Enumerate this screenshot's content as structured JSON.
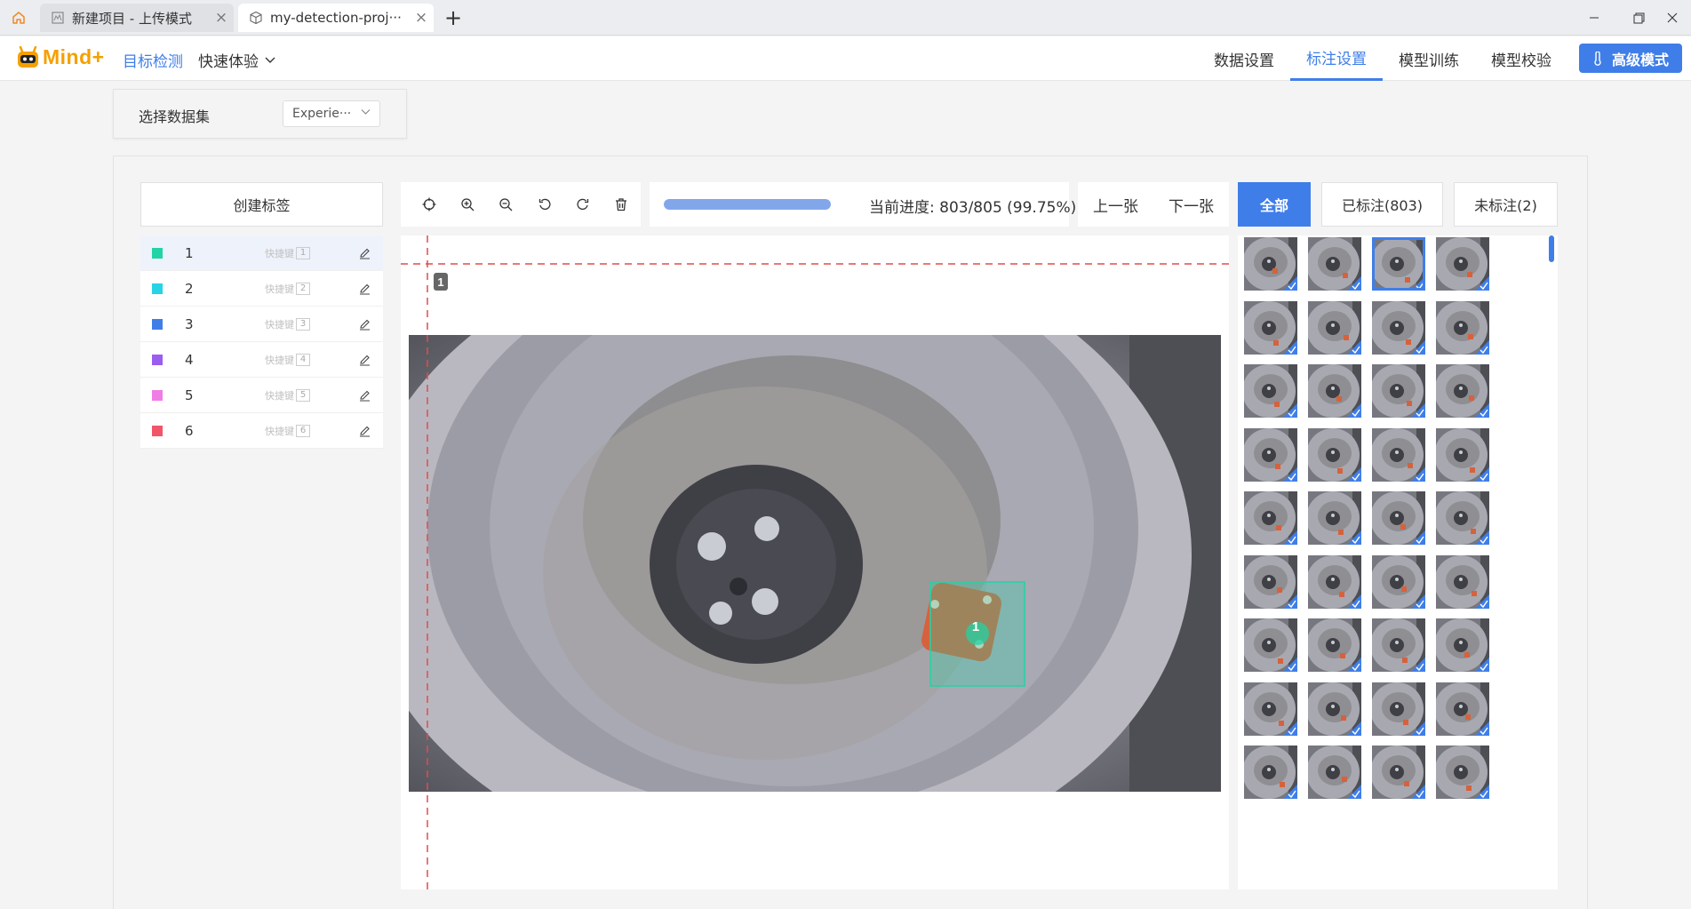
{
  "titlebar": {
    "tabs": [
      {
        "label": "新建项目 - 上传模式"
      },
      {
        "label": "my-detection-proj···"
      }
    ]
  },
  "navbar": {
    "logo_text": "Mind+",
    "mode": "目标检测",
    "experience": "快速体验",
    "tabs": [
      {
        "label": "数据设置",
        "active": false
      },
      {
        "label": "标注设置",
        "active": true
      },
      {
        "label": "模型训练",
        "active": false
      },
      {
        "label": "模型校验",
        "active": false
      }
    ],
    "advanced_label": "高级模式"
  },
  "dataset": {
    "label": "选择数据集",
    "selected": "Experie···"
  },
  "labels": {
    "create_label": "创建标签",
    "shortcut_text": "快捷键",
    "items": [
      {
        "name": "1",
        "key": "1",
        "color": "#22d3a6"
      },
      {
        "name": "2",
        "key": "2",
        "color": "#29d3e6"
      },
      {
        "name": "3",
        "key": "3",
        "color": "#3f7ee8"
      },
      {
        "name": "4",
        "key": "4",
        "color": "#9b5cf0"
      },
      {
        "name": "5",
        "key": "5",
        "color": "#f07de6"
      },
      {
        "name": "6",
        "key": "6",
        "color": "#f0556a"
      }
    ]
  },
  "toolbar": {
    "icons": [
      "crosshair-icon",
      "zoom-in-icon",
      "zoom-out-icon",
      "rotate-left-icon",
      "rotate-right-icon",
      "trash-icon"
    ]
  },
  "progress": {
    "text": "当前进度: 803/805 (99.75%)",
    "fraction": 0.9975
  },
  "nav": {
    "prev": "上一张",
    "next": "下一张"
  },
  "filters": {
    "all": "全部",
    "labeled": "已标注(803)",
    "unlabeled": "未标注(2)"
  },
  "canvas": {
    "guide_label": "1",
    "box_label": "1",
    "box_color": "#22d3a6"
  },
  "thumbnails": {
    "rows": 9,
    "cols": 4,
    "selected_index": 2
  },
  "colors": {
    "accent": "#3f7ee8",
    "logo": "#f5a000"
  }
}
